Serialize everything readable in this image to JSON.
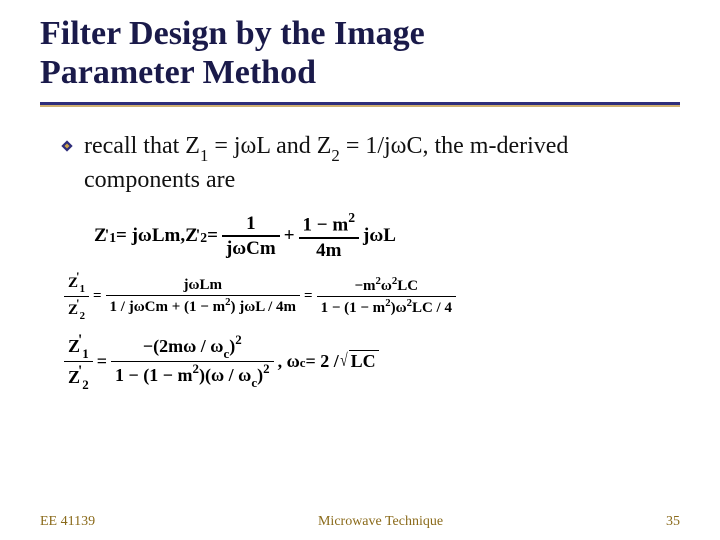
{
  "title_line1": "Filter Design by the Image",
  "title_line2": "Parameter Method",
  "bullet": {
    "pre": "recall that Z",
    "sub1": "1",
    "mid1": " = jωL and Z",
    "sub2": "2",
    "mid2": " = 1/jωC, the m-derived components are"
  },
  "eq1": {
    "lhsA": "Z",
    "lhsAprime": "'",
    "lhsAsub": "1",
    "eqA": " = jωLm, ",
    "lhsB": "Z",
    "lhsBprime": "'",
    "lhsBsub": "2",
    "eqB": " = ",
    "f1num": "1",
    "f1den": "jωCm",
    "plus": " + ",
    "f2num": "1 − m",
    "f2numsup": "2",
    "f2den": "4m",
    "tail": " jωL"
  },
  "eq2": {
    "lhs_num": "Z",
    "lhs_num_prime": "'",
    "lhs_num_sub": "1",
    "lhs_den": "Z",
    "lhs_den_prime": "'",
    "lhs_den_sub": "2",
    "eq": " = ",
    "m1num": "jωLm",
    "m1den_a": "1 / jωCm + (1 − m",
    "m1den_sup": "2",
    "m1den_b": ") jωL / 4m",
    "eq2": " = ",
    "r_num_a": "−m",
    "r_num_sup1": "2",
    "r_num_b": "ω",
    "r_num_sup2": "2",
    "r_num_c": "LC",
    "r_den_a": "1 − (1 − m",
    "r_den_sup1": "2",
    "r_den_b": ")ω",
    "r_den_sup2": "2",
    "r_den_c": "LC / 4"
  },
  "eq3": {
    "lhs_num": "Z",
    "lhs_num_prime": "'",
    "lhs_num_sub": "1",
    "lhs_den": "Z",
    "lhs_den_prime": "'",
    "lhs_den_sub": "2",
    "eq": " = ",
    "num_a": "−(2mω / ω",
    "num_csub": "c",
    "num_b": ")",
    "num_sup": "2",
    "den_a": "1 − (1 − m",
    "den_sup1": "2",
    "den_b": ")(ω / ω",
    "den_csub": "c",
    "den_c": ")",
    "den_sup2": "2",
    "comma": " , ω",
    "omega_csub": "c",
    "tail": " = 2 / ",
    "rad": "LC"
  },
  "footer": {
    "left": "EE 41139",
    "center": "Microwave Technique",
    "right": "35"
  }
}
